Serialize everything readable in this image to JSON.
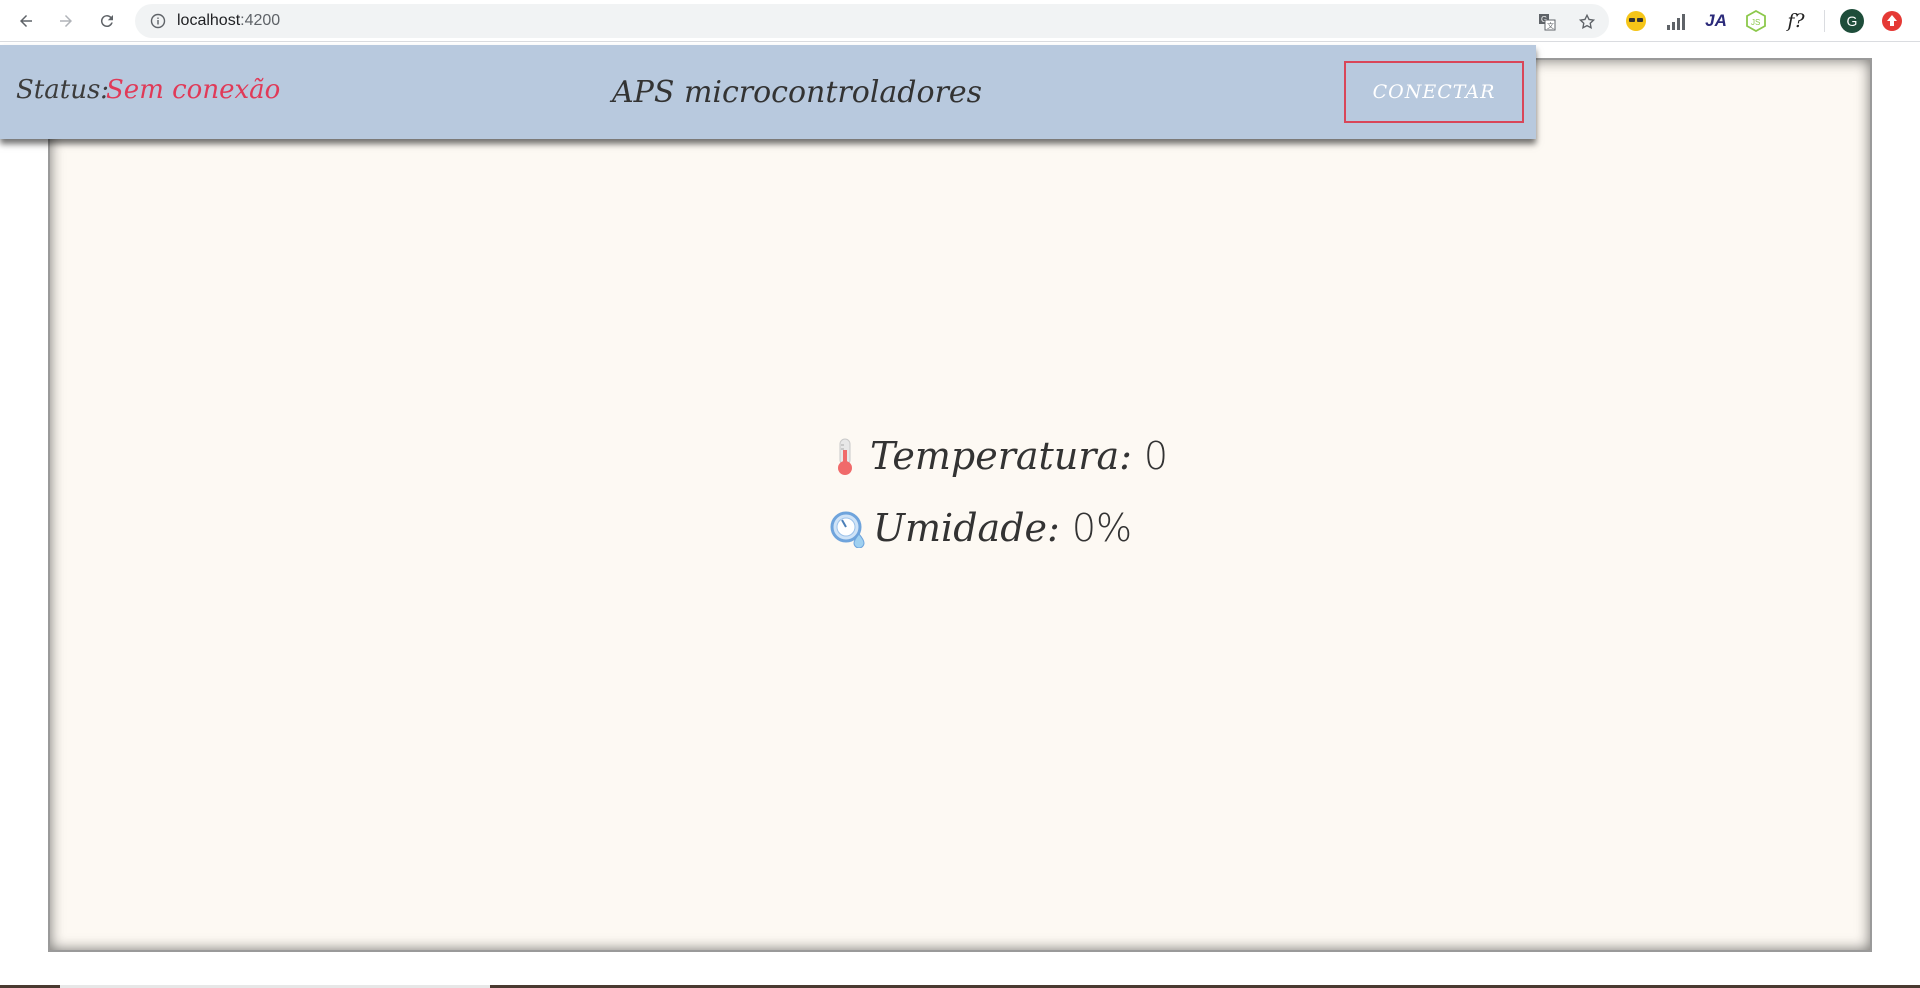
{
  "browser": {
    "url_host": "localhost",
    "url_port": ":4200",
    "icons": {
      "back": "back-arrow-icon",
      "forward": "forward-arrow-icon",
      "reload": "reload-icon",
      "info": "info-icon",
      "translate": "translate-icon",
      "bookmark": "star-icon"
    },
    "extensions": [
      {
        "name": "sunglasses-extension-icon"
      },
      {
        "name": "signal-bars-extension-icon"
      },
      {
        "name": "ja-extension-icon",
        "text": "JA"
      },
      {
        "name": "nodejs-extension-icon"
      },
      {
        "name": "font-finder-extension-icon",
        "text": "f?"
      },
      {
        "name": "profile-avatar-icon",
        "text": "G"
      },
      {
        "name": "update-extension-icon"
      }
    ]
  },
  "header": {
    "status_label": "Status:",
    "status_value": "Sem conexão",
    "title": "APS microcontroladores",
    "connect_label": "CONECTAR"
  },
  "readings": {
    "temperature_label": "Temperatura:",
    "temperature_value": "0",
    "humidity_label": "Umidade:",
    "humidity_value": "0%"
  },
  "colors": {
    "header_bg": "#b8c9de",
    "status_error": "#e03a58",
    "button_border": "#d94659",
    "panel_bg": "#fdf9f3"
  }
}
